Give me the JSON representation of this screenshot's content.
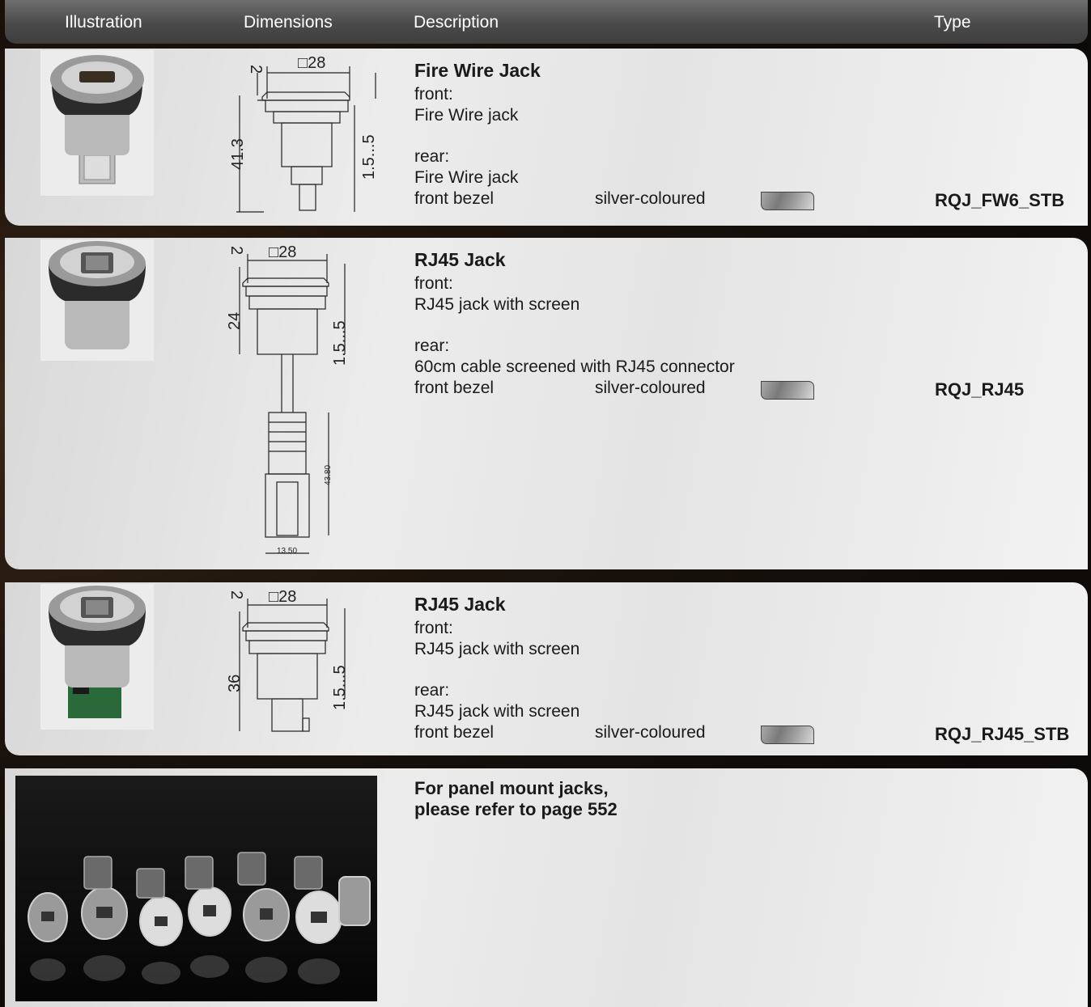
{
  "header": {
    "col_illustration": "Illustration",
    "col_dimensions": "Dimensions",
    "col_description": "Description",
    "col_type": "Type"
  },
  "products": [
    {
      "title": "Fire Wire Jack",
      "front_label": "front:",
      "front_value": "Fire Wire jack",
      "rear_label": "rear:",
      "rear_value": "Fire Wire jack",
      "bezel_label": "front bezel",
      "bezel_color": "silver-coloured",
      "type": "RQJ_FW6_STB",
      "dims": {
        "top": "2",
        "square": "□28",
        "height": "41.3",
        "range": "1.5...5"
      }
    },
    {
      "title": "RJ45 Jack",
      "front_label": "front:",
      "front_value": "RJ45 jack with screen",
      "rear_label": "rear:",
      "rear_value": "60cm cable screened with RJ45 connector",
      "bezel_label": "front bezel",
      "bezel_color": "silver-coloured",
      "type": "RQJ_RJ45",
      "dims": {
        "top": "2",
        "square": "□28",
        "height": "24",
        "range": "1.5...5",
        "plug_len": "43.80",
        "plug_w": "13.50"
      }
    },
    {
      "title": "RJ45 Jack",
      "front_label": "front:",
      "front_value": "RJ45 jack with screen",
      "rear_label": "rear:",
      "rear_value": "RJ45 jack with screen",
      "bezel_label": "front bezel",
      "bezel_color": "silver-coloured",
      "type": "RQJ_RJ45_STB",
      "dims": {
        "top": "2",
        "square": "□28",
        "height": "36",
        "range": "1.5...5"
      }
    }
  ],
  "note": {
    "line1": "For panel mount jacks,",
    "line2": "please refer to page 552"
  },
  "colors": {
    "header": "#4a4a4a",
    "row_bg": "#e6e6e6",
    "swatch": "#8a8a8a"
  }
}
